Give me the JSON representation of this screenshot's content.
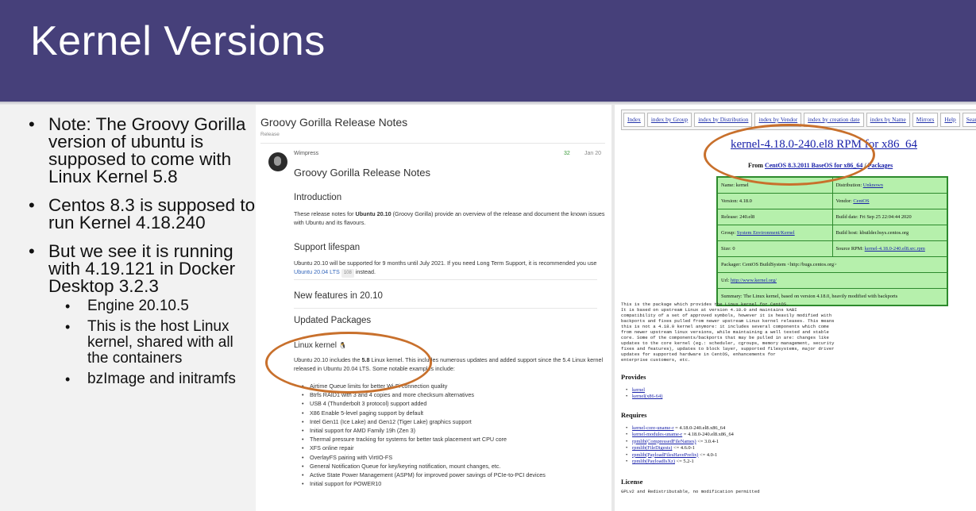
{
  "slide": {
    "title": "Kernel Versions",
    "bullets": [
      "Note: The Groovy Gorilla version of ubuntu is supposed to come with Linux Kernel 5.8",
      "Centos 8.3 is supposed to run Kernel 4.18.240",
      "But we see it is running with 4.19.121 in Docker Desktop 3.2.3"
    ],
    "sub_bullets": [
      "Engine 20.10.5",
      "This is the host Linux kernel, shared with all the containers",
      "bzImage and initramfs"
    ]
  },
  "ubuntu": {
    "page_title": "Groovy Gorilla Release Notes",
    "category": "Release",
    "author": "Wimpress",
    "likes": "32",
    "date": "Jan 20",
    "post_title": "Groovy Gorilla Release Notes",
    "intro_heading": "Introduction",
    "intro_text_pre": "These release notes for ",
    "intro_text_bold": "Ubuntu 20.10",
    "intro_text_post": " (Groovy Gorilla) provide an overview of the release and document the known issues with Ubuntu and its flavours.",
    "support_heading": "Support lifespan",
    "support_text_pre": "Ubuntu 20.10 will be supported for 9 months until July 2021. If you need Long Term Support, it is recommended you use ",
    "support_link": "Ubuntu 20.04 LTS",
    "support_badge": "108",
    "support_text_post": " instead.",
    "features_heading": "New features in 20.10",
    "packages_heading": "Updated Packages",
    "kernel_heading": "Linux kernel",
    "kernel_text_pre": "Ubuntu 20.10 includes the ",
    "kernel_text_bold": "5.8",
    "kernel_text_post": " Linux kernel. This includes numerous updates and added support since the 5.4 Linux kernel released in Ubuntu 20.04 LTS. Some notable examples include:",
    "features": [
      "Airtime Queue limits for better Wi-Fi connection quality",
      "Btrfs RAID1 with 3 and 4 copies and more checksum alternatives",
      "USB 4 (Thunderbolt 3 protocol) support added",
      "X86 Enable 5-level paging support by default",
      "Intel Gen11 (Ice Lake) and Gen12 (Tiger Lake) graphics support",
      "Initial support for AMD Family 19h (Zen 3)",
      "Thermal pressure tracking for systems for better task placement wrt CPU core",
      "XFS online repair",
      "OverlayFS pairing with VirtIO-FS",
      "General Notification Queue for key/keyring notification, mount changes, etc.",
      "Active State Power Management (ASPM) for improved power savings of PCIe-to-PCI devices",
      "Initial support for POWER10"
    ]
  },
  "centos": {
    "nav": [
      "Index",
      "index by Group",
      "index by Distribution",
      "index by Vendor",
      "index by creation date",
      "index by Name",
      "Mirrors",
      "Help",
      "Search"
    ],
    "rpm_title": "kernel-4.18.0-240.el8 RPM for x86_64",
    "from_label": "From",
    "from_link": "CentOS 8.3.2011 BaseOS for x86_64",
    "from_sep": " / ",
    "packages_link": "Packages",
    "table": {
      "name_label": "Name: kernel",
      "distribution_label": "Distribution: ",
      "distribution_value": "Unknown",
      "version": "Version: 4.18.0",
      "vendor_label": "Vendor: ",
      "vendor_value": "CentOS",
      "release": "Release: 240.el8",
      "build_date": "Build date: Fri Sep 25 22:04:44 2020",
      "group_label": "Group: ",
      "group_value": "System Environment/Kernel",
      "build_host": "Build host: kbuilder.bsys.centos.org",
      "size": "Size: 0",
      "source_label": "Source RPM: ",
      "source_value": "kernel-4.18.0-240.el8.src.rpm",
      "packager": "Packager: CentOS BuildSystem <http://bugs.centos.org>",
      "url_label": "Url: ",
      "url_value": "http://www.kernel.org/",
      "summary": "Summary: The Linux kernel, based on version 4.18.0, heavily modified with backports"
    },
    "description": "This is the package which provides the Linux kernel for CentOS.\nIt is based on upstream Linux at version 4.18.0 and maintains kABI\ncompatibility of a set of approved symbols, however it is heavily modified with\nbackports and fixes pulled from newer upstream Linux kernel releases. This means\nthis is not a 4.18.0 kernel anymore: it includes several components which come\nfrom newer upstream linux versions, while maintaining a well tested and stable\ncore. Some of the components/backports that may be pulled in are: changes like\nupdates to the core kernel (eg.: scheduler, cgroups, memory management, security\nfixes and features), updates to block layer, supported filesystems, major driver\nupdates for supported hardware in CentOS, enhancements for\nenterprise customers, etc.",
    "provides_heading": "Provides",
    "provides": [
      "kernel",
      "kernel(x86-64)"
    ],
    "requires_heading": "Requires",
    "requires": [
      {
        "link": "kernel-core-uname-r",
        "rest": " = 4.18.0-240.el8.x86_64"
      },
      {
        "link": "kernel-modules-uname-r",
        "rest": " = 4.18.0-240.el8.x86_64"
      },
      {
        "link": "rpmlib(CompressedFileNames)",
        "rest": " <= 3.0.4-1"
      },
      {
        "link": "rpmlib(FileDigests)",
        "rest": " <= 4.6.0-1"
      },
      {
        "link": "rpmlib(PayloadFilesHavePrefix)",
        "rest": " <= 4.0-1"
      },
      {
        "link": "rpmlib(PayloadIsXz)",
        "rest": " <= 5.2-1"
      }
    ],
    "license_heading": "License",
    "license_text": "GPLv2 and Redistributable, no modification permitted"
  },
  "colors": {
    "header": "#46407a",
    "highlight_ring": "#c8702c",
    "rpm_table": "#b6f0ac"
  }
}
